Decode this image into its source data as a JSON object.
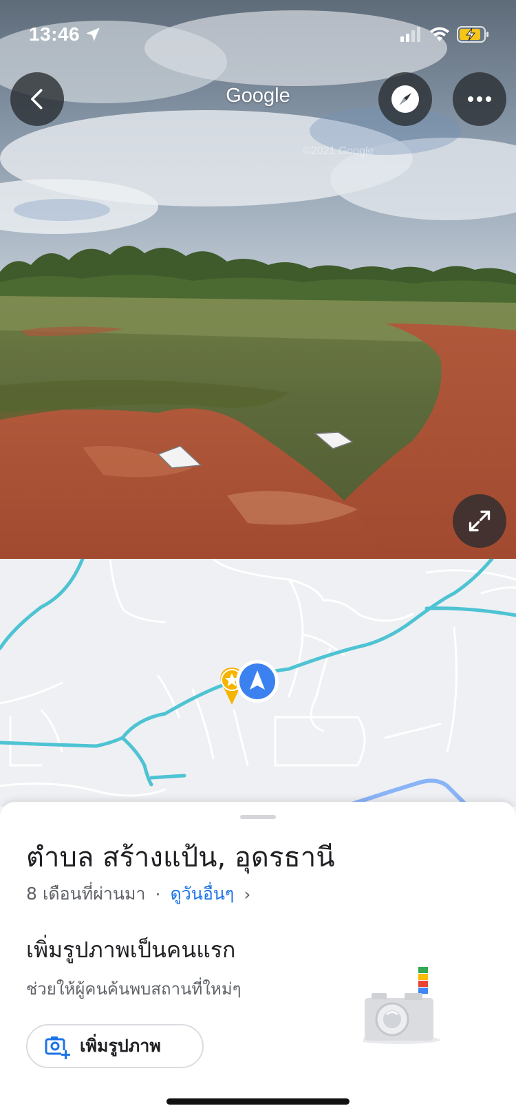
{
  "status_bar": {
    "time": "13:46"
  },
  "header": {
    "title": "Google"
  },
  "place": {
    "title": "ตำบล สร้างแป้น, อุดรธานี",
    "age": "8 เดือนที่ผ่านมา",
    "separator": "·",
    "see_more": "ดูวันอื่นๆ",
    "chevron": "›"
  },
  "add_photo": {
    "heading": "เพิ่มรูปภาพเป็นคนแรก",
    "subtext": "ช่วยให้ผู้คนค้นพบสถานที่ใหม่ๆ",
    "button_label": "เพิ่มรูปภาพ"
  },
  "watermark": "©2021 Google",
  "icons": {
    "back": "chevron-left-icon",
    "compass": "compass-icon",
    "more": "more-horizontal-icon",
    "expand": "expand-icon",
    "location_arrow": "location-arrow-icon",
    "signal": "cellular-signal-icon",
    "wifi": "wifi-icon",
    "battery": "battery-charging-icon",
    "camera_add": "add-photo-icon",
    "favorite_pin": "star-pin-icon",
    "current_location": "navigation-arrow-icon"
  },
  "colors": {
    "accent": "#1a73e8",
    "road": "#4ec3d3",
    "battery": "#f5c518",
    "pin": "#f4b400"
  }
}
